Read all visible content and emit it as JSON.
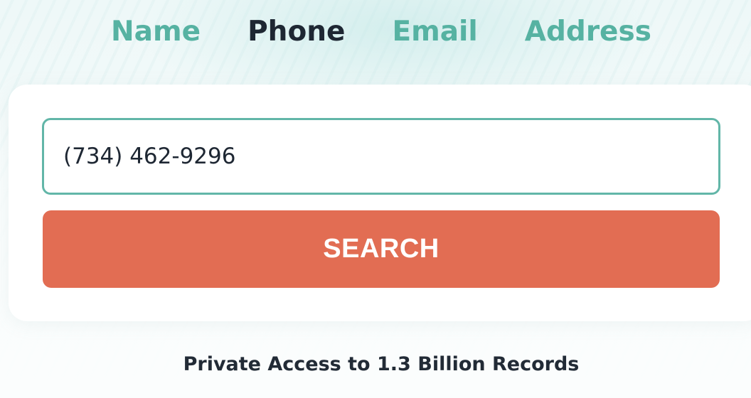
{
  "tabs": [
    {
      "label": "Name",
      "active": false
    },
    {
      "label": "Phone",
      "active": true
    },
    {
      "label": "Email",
      "active": false
    },
    {
      "label": "Address",
      "active": false
    }
  ],
  "search": {
    "value": "(734) 462-9296",
    "button_label": "SEARCH"
  },
  "tagline": "Private Access to 1.3 Billion Records",
  "colors": {
    "accent": "#56b2a2",
    "active_tab": "#1e2733",
    "button": "#e26d53",
    "input_border": "#62b6a8"
  }
}
